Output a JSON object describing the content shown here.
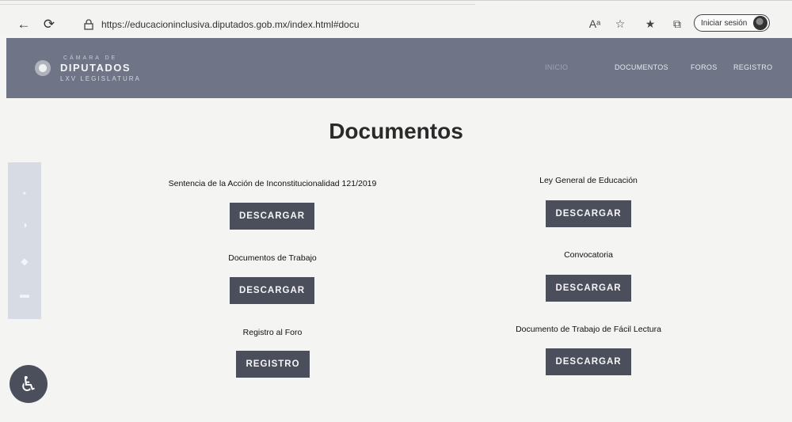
{
  "browser": {
    "url": "https://educacioninclusiva.diputados.gob.mx/index.html#docu",
    "signin_label": "Iniciar sesión"
  },
  "header": {
    "logo_top": "CÁMARA DE",
    "logo_main": "DIPUTADOS",
    "logo_sub": "LXV LEGISLATURA",
    "nav": [
      "INICIO",
      "DOCUMENTOS",
      "FOROS",
      "REGISTRO"
    ]
  },
  "main": {
    "title": "Documentos",
    "documents": [
      {
        "label": "Sentencia de la Acción de Inconstitucionalidad 121/2019",
        "button": "DESCARGAR"
      },
      {
        "label": "Ley General de Educación",
        "button": "DESCARGAR"
      },
      {
        "label": "Documentos de Trabajo",
        "button": "DESCARGAR"
      },
      {
        "label": "Convocatoria",
        "button": "DESCARGAR"
      },
      {
        "label": "Registro al Foro",
        "button": "REGISTRO"
      },
      {
        "label": "Documento de Trabajo de Fácil Lectura",
        "button": "DESCARGAR"
      }
    ]
  },
  "icons": {
    "back": "arrow-left-icon",
    "reload": "reload-icon",
    "lock": "lock-icon",
    "accessibility": "wheelchair-icon"
  }
}
